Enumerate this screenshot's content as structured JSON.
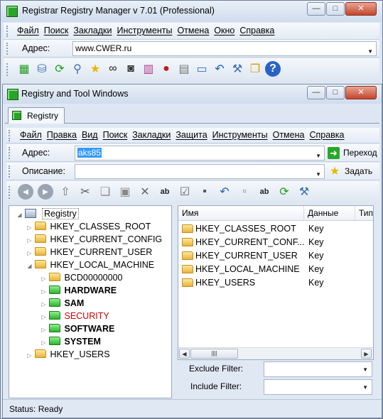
{
  "outer": {
    "title": "Registrar Registry Manager v 7.01 (Professional)",
    "menu": [
      "Файл",
      "Поиск",
      "Закладки",
      "Инструменты",
      "Отмена",
      "Окно",
      "Справка"
    ],
    "address_label": "Адрес:",
    "address_value": "www.CWER.ru",
    "toolbar_icons": [
      "grid-icon",
      "network-icon",
      "refresh-icon",
      "search-icon",
      "star-icon",
      "binoculars-icon",
      "camera-icon",
      "books-icon",
      "cherries-icon",
      "printer-icon",
      "monitor-icon",
      "undo-icon",
      "tools-icon",
      "windows-icon",
      "help-icon"
    ],
    "window_buttons": {
      "minimize": "—",
      "maximize": "□",
      "close": "✕"
    }
  },
  "inner": {
    "title": "Registry and Tool Windows",
    "tab_label": "Registry",
    "menu": [
      "Файл",
      "Правка",
      "Вид",
      "Поиск",
      "Закладки",
      "Защита",
      "Инструменты",
      "Отмена",
      "Справка"
    ],
    "address_label": "Адрес:",
    "address_value": "aks85",
    "go_label": "Переход",
    "description_label": "Описание:",
    "description_value": "",
    "set_label": "Задать",
    "toolbar_icons": [
      "back-icon",
      "forward-icon",
      "up-icon",
      "cut-icon",
      "copy-icon",
      "paste-icon",
      "delete-icon",
      "rename-icon",
      "properties-icon",
      "save-icon",
      "undo-icon",
      "new-key-icon",
      "new-value-icon",
      "refresh-icon",
      "tools-icon"
    ]
  },
  "tree": {
    "root": "Registry",
    "items": [
      {
        "label": "HKEY_CLASSES_ROOT",
        "level": 1,
        "bold": false,
        "color": "#000000"
      },
      {
        "label": "HKEY_CURRENT_CONFIG",
        "level": 1,
        "bold": false,
        "color": "#000000"
      },
      {
        "label": "HKEY_CURRENT_USER",
        "level": 1,
        "bold": false,
        "color": "#000000"
      },
      {
        "label": "HKEY_LOCAL_MACHINE",
        "level": 1,
        "bold": false,
        "color": "#000000"
      },
      {
        "label": "BCD00000000",
        "level": 2,
        "bold": false,
        "color": "#000000"
      },
      {
        "label": "HARDWARE",
        "level": 2,
        "bold": true,
        "color": "#000000"
      },
      {
        "label": "SAM",
        "level": 2,
        "bold": true,
        "color": "#000000"
      },
      {
        "label": "SECURITY",
        "level": 2,
        "bold": false,
        "color": "#cc0000"
      },
      {
        "label": "SOFTWARE",
        "level": 2,
        "bold": true,
        "color": "#000000"
      },
      {
        "label": "SYSTEM",
        "level": 2,
        "bold": true,
        "color": "#000000"
      },
      {
        "label": "HKEY_USERS",
        "level": 1,
        "bold": false,
        "color": "#000000"
      }
    ]
  },
  "list": {
    "columns": [
      "Имя",
      "Данные",
      "Тип"
    ],
    "rows": [
      {
        "name": "HKEY_CLASSES_ROOT",
        "data": "Key"
      },
      {
        "name": "HKEY_CURRENT_CONF...",
        "data": "Key"
      },
      {
        "name": "HKEY_CURRENT_USER",
        "data": "Key"
      },
      {
        "name": "HKEY_LOCAL_MACHINE",
        "data": "Key"
      },
      {
        "name": "HKEY_USERS",
        "data": "Key"
      }
    ]
  },
  "filters": {
    "exclude_label": "Exclude Filter:",
    "include_label": "Include Filter:"
  },
  "status": "Status: Ready",
  "colors": {
    "accent": "#3399ff",
    "selection": "#3399ff",
    "security": "#cc0000"
  }
}
